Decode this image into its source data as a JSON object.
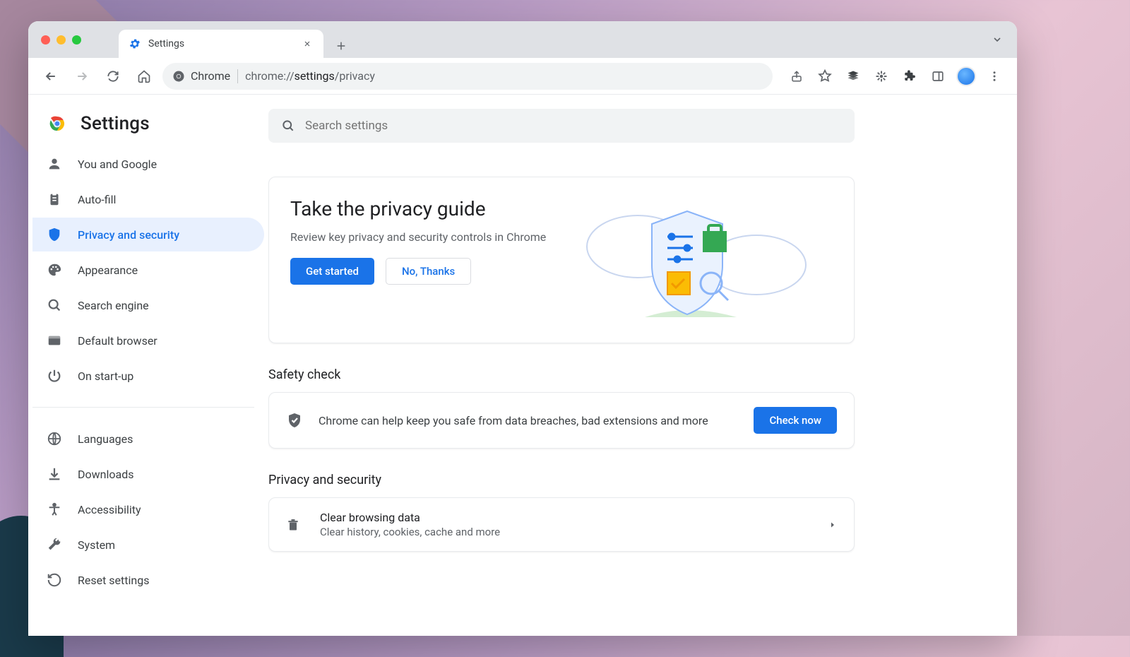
{
  "tab": {
    "title": "Settings"
  },
  "omnibox": {
    "chip": "Chrome",
    "url_prefix": "chrome://",
    "url_bold": "settings",
    "url_suffix": "/privacy"
  },
  "header": {
    "title": "Settings"
  },
  "search": {
    "placeholder": "Search settings"
  },
  "sidebar": {
    "items": [
      {
        "label": "You and Google"
      },
      {
        "label": "Auto-fill"
      },
      {
        "label": "Privacy and security"
      },
      {
        "label": "Appearance"
      },
      {
        "label": "Search engine"
      },
      {
        "label": "Default browser"
      },
      {
        "label": "On start-up"
      },
      {
        "label": "Languages"
      },
      {
        "label": "Downloads"
      },
      {
        "label": "Accessibility"
      },
      {
        "label": "System"
      },
      {
        "label": "Reset settings"
      }
    ]
  },
  "promo": {
    "title": "Take the privacy guide",
    "subtitle": "Review key privacy and security controls in Chrome",
    "primary": "Get started",
    "secondary": "No, Thanks"
  },
  "sections": {
    "safety_title": "Safety check",
    "safety_text": "Chrome can help keep you safe from data breaches, bad extensions and more",
    "safety_button": "Check now",
    "privacy_title": "Privacy and security",
    "clear_title": "Clear browsing data",
    "clear_sub": "Clear history, cookies, cache and more"
  }
}
